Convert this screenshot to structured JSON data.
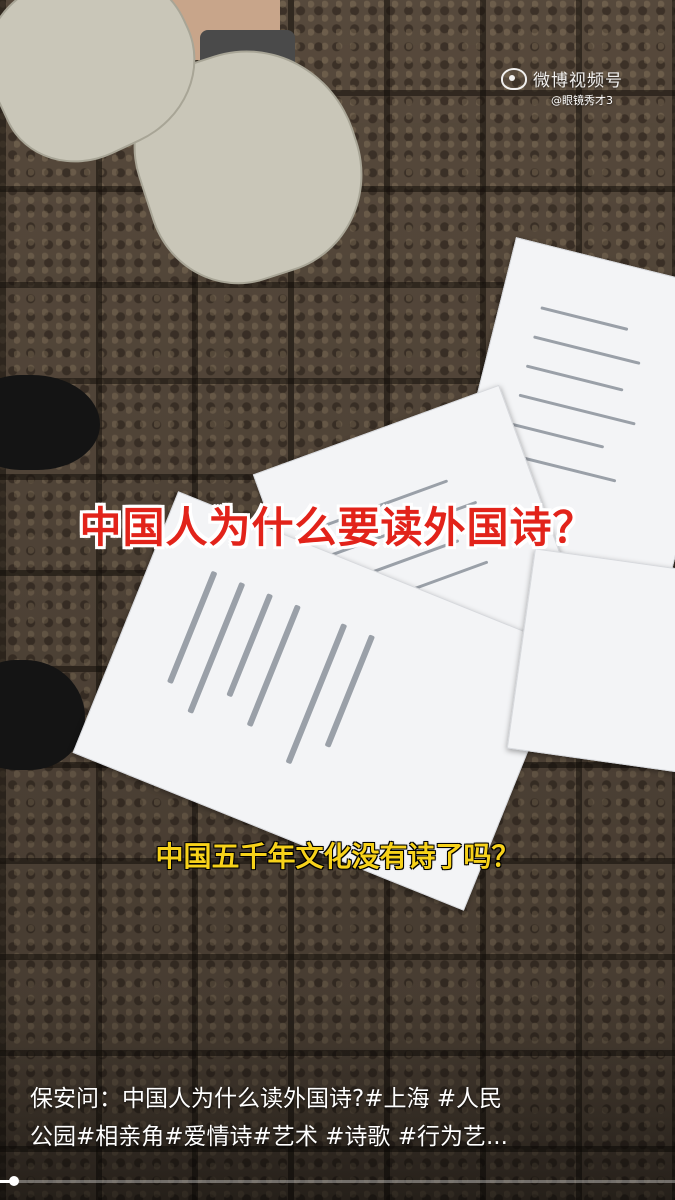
{
  "watermark": {
    "brand": "微博视频号",
    "handle": "@眼镜秀才3",
    "logo_icon": "weibo-logo-icon"
  },
  "captions": {
    "title": "中国人为什么要读外国诗？",
    "subtitle": "中国五千年文化没有诗了吗？"
  },
  "description": {
    "line1": "保安问：中国人为什么读外国诗?#上海 #人民",
    "line2": "公园#相亲角#爱情诗#艺术 #诗歌 #行为艺..."
  },
  "progress": {
    "fraction": 0.02
  },
  "colors": {
    "title_red": "#e2231a",
    "subtitle_yellow": "#f7d21a"
  }
}
